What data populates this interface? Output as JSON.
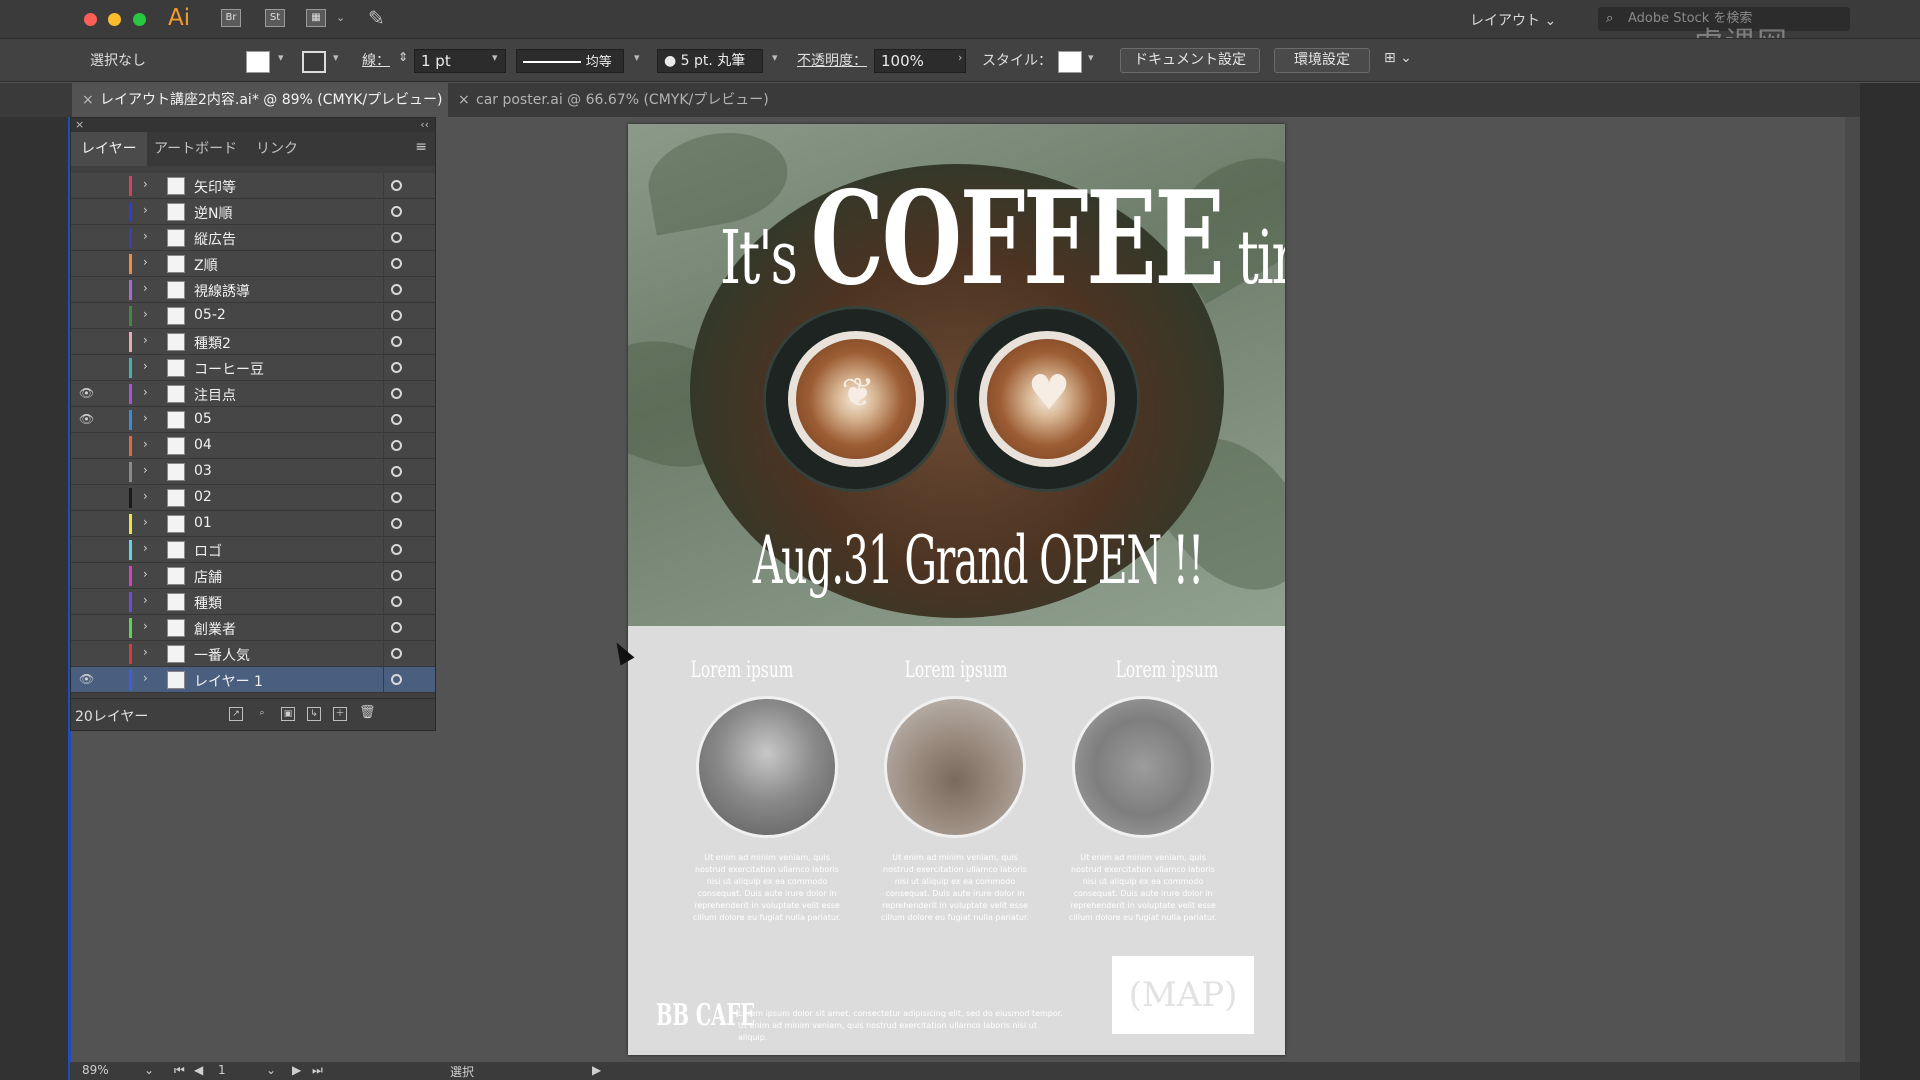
{
  "app": {
    "logo": "Ai",
    "bridge": "Br",
    "stock": "St",
    "workspace": "レイアウト",
    "stock_search_placeholder": "Adobe Stock を検索"
  },
  "control": {
    "selection": "選択なし",
    "stroke_label": "線：",
    "stroke_value": "1 pt",
    "profile": "均等",
    "brush": "5 pt. 丸筆",
    "opacity_label": "不透明度：",
    "opacity_value": "100%",
    "style_label": "スタイル：",
    "doc_setup": "ドキュメント設定",
    "preferences": "環境設定"
  },
  "tabs": [
    {
      "label": "レイアウト講座2内容.ai* @ 89% (CMYK/プレビュー)",
      "active": true
    },
    {
      "label": "car poster.ai @ 66.67% (CMYK/プレビュー)",
      "active": false
    }
  ],
  "layers_panel": {
    "tabs": [
      "レイヤー",
      "アートボード",
      "リンク"
    ],
    "count": "20レイヤー",
    "layers": [
      {
        "name": "矢印等",
        "color": "#d6405a",
        "visible": false,
        "selected": false
      },
      {
        "name": "逆N順",
        "color": "#2a3fd6",
        "visible": false,
        "selected": false
      },
      {
        "name": "縦広告",
        "color": "#3b3fb0",
        "visible": false,
        "selected": false
      },
      {
        "name": "Z順",
        "color": "#f28c3a",
        "visible": false,
        "selected": false
      },
      {
        "name": "視線誘導",
        "color": "#a76ad8",
        "visible": false,
        "selected": false
      },
      {
        "name": "05-2",
        "color": "#3f8a3f",
        "visible": false,
        "selected": false
      },
      {
        "name": "種類2",
        "color": "#e8a9b6",
        "visible": false,
        "selected": false
      },
      {
        "name": "コーヒー豆",
        "color": "#3fb3b3",
        "visible": false,
        "selected": false
      },
      {
        "name": "注目点",
        "color": "#a653d6",
        "visible": true,
        "selected": false
      },
      {
        "name": "05",
        "color": "#3a8adf",
        "visible": true,
        "selected": false
      },
      {
        "name": "04",
        "color": "#e06a3a",
        "visible": false,
        "selected": false
      },
      {
        "name": "03",
        "color": "#8a8a8a",
        "visible": false,
        "selected": false
      },
      {
        "name": "02",
        "color": "#1a1a1a",
        "visible": false,
        "selected": false
      },
      {
        "name": "01",
        "color": "#f0e040",
        "visible": false,
        "selected": false
      },
      {
        "name": "ロゴ",
        "color": "#5fd6e8",
        "visible": false,
        "selected": false
      },
      {
        "name": "店舗",
        "color": "#d640c0",
        "visible": false,
        "selected": false
      },
      {
        "name": "種類",
        "color": "#6a4ae0",
        "visible": false,
        "selected": false
      },
      {
        "name": "創業者",
        "color": "#58d658",
        "visible": false,
        "selected": false
      },
      {
        "name": "一番人気",
        "color": "#d63a3a",
        "visible": false,
        "selected": false
      },
      {
        "name": "レイヤー 1",
        "color": "#3a5ee8",
        "visible": true,
        "selected": true
      }
    ]
  },
  "poster": {
    "headline_pre": "It's",
    "headline_big": "COFFEE",
    "headline_post": "time !!",
    "subline": "Aug.31 Grand OPEN !!",
    "columns": [
      {
        "title": "Lorem ipsum",
        "body": "Ut enim ad minim veniam, quis nostrud exercitation ullamco laboris nisi ut aliquip ex ea commodo consequat. Duis aute irure dolor in reprehenderit in voluptate velit esse cillum dolore eu fugiat nulla pariatur."
      },
      {
        "title": "Lorem ipsum",
        "body": "Ut enim ad minim veniam, quis nostrud exercitation ullamco laboris nisi ut aliquip ex ea commodo consequat. Duis aute irure dolor in reprehenderit in voluptate velit esse cillum dolore eu fugiat nulla pariatur."
      },
      {
        "title": "Lorem ipsum",
        "body": "Ut enim ad minim veniam, quis nostrud exercitation ullamco laboris nisi ut aliquip ex ea commodo consequat. Duis aute irure dolor in reprehenderit in voluptate velit esse cillum dolore eu fugiat nulla pariatur."
      }
    ],
    "logo": "BB CAFE",
    "footer": "Lorem ipsum dolor sit amet, consectetur adipisicing elit, sed do eiusmod tempor. Ut enim ad minim veniam, quis nostrud exercitation ullamco laboris nisi ut aliquip.",
    "map": "(MAP)"
  },
  "status": {
    "zoom": "89%",
    "artboard": "1",
    "tool": "選択"
  },
  "watermark": "虎课网"
}
